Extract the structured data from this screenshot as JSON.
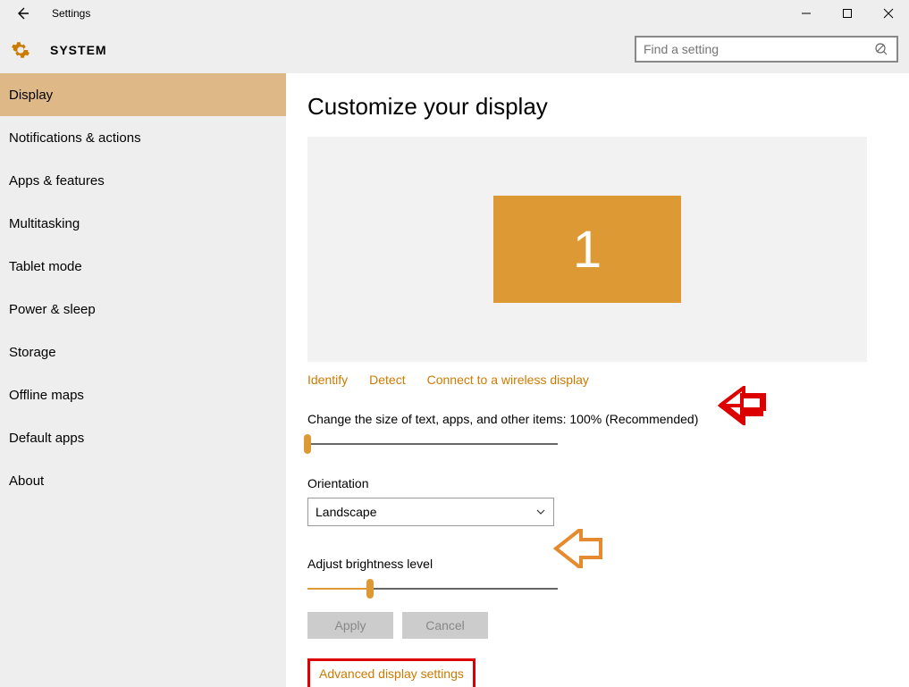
{
  "titlebar": {
    "app_name": "Settings"
  },
  "header": {
    "title": "SYSTEM",
    "search_placeholder": "Find a setting"
  },
  "sidebar": {
    "items": [
      {
        "label": "Display",
        "active": true
      },
      {
        "label": "Notifications & actions",
        "active": false
      },
      {
        "label": "Apps & features",
        "active": false
      },
      {
        "label": "Multitasking",
        "active": false
      },
      {
        "label": "Tablet mode",
        "active": false
      },
      {
        "label": "Power & sleep",
        "active": false
      },
      {
        "label": "Storage",
        "active": false
      },
      {
        "label": "Offline maps",
        "active": false
      },
      {
        "label": "Default apps",
        "active": false
      },
      {
        "label": "About",
        "active": false
      }
    ]
  },
  "main": {
    "page_title": "Customize your display",
    "monitor_number": "1",
    "links": {
      "identify": "Identify",
      "detect": "Detect",
      "wireless": "Connect to a wireless display"
    },
    "scale_label": "Change the size of text, apps, and other items: 100% (Recommended)",
    "scale_value_pct": 0,
    "orientation_label": "Orientation",
    "orientation_value": "Landscape",
    "brightness_label": "Adjust brightness level",
    "brightness_value_pct": 25,
    "apply_label": "Apply",
    "cancel_label": "Cancel",
    "advanced_link": "Advanced display settings"
  },
  "annotations": {
    "arrow_red": {
      "color": "#d00",
      "target": "scale-slider"
    },
    "arrow_orange": {
      "color": "#e58a2e",
      "target": "brightness-slider"
    }
  }
}
